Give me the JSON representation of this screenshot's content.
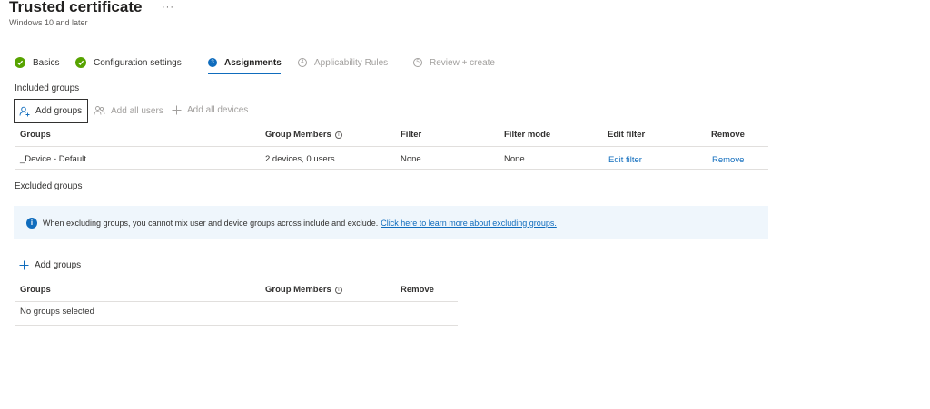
{
  "page": {
    "title": "Trusted certificate",
    "ellipsis": "···",
    "subtitle": "Windows 10 and later"
  },
  "steps": [
    {
      "label": "Basics",
      "state": "complete"
    },
    {
      "label": "Configuration settings",
      "state": "complete"
    },
    {
      "label": "Assignments",
      "state": "active",
      "number": "3"
    },
    {
      "label": "Applicability Rules",
      "state": "pending",
      "number": "4"
    },
    {
      "label": "Review + create",
      "state": "pending",
      "number": "5"
    }
  ],
  "included": {
    "heading": "Included groups",
    "commands": {
      "add_groups": "Add groups",
      "add_all_users": "Add all users",
      "add_all_devices": "Add all devices"
    },
    "columns": {
      "groups": "Groups",
      "group_members": "Group Members",
      "filter": "Filter",
      "filter_mode": "Filter mode",
      "edit_filter": "Edit filter",
      "remove": "Remove"
    },
    "rows": [
      {
        "group": "_Device - Default",
        "members": "2 devices, 0 users",
        "filter": "None",
        "filter_mode": "None",
        "edit_filter": "Edit filter",
        "remove": "Remove"
      }
    ]
  },
  "excluded": {
    "heading": "Excluded groups",
    "info_icon": "i",
    "info_text": "When excluding groups, you cannot mix user and device groups across include and exclude.",
    "info_link": "Click here to learn more about excluding groups.",
    "add_groups": "Add groups",
    "columns": {
      "groups": "Groups",
      "group_members": "Group Members",
      "remove": "Remove"
    },
    "empty_text": "No groups selected"
  },
  "colors": {
    "accent": "#0f6cbd",
    "success": "#57a300",
    "info_background": "#eff6fc"
  },
  "icons": {
    "step_complete": "checkmark-circle-icon",
    "info": "info-icon",
    "add_groups": "person-add-icon",
    "add_all_users": "people-icon",
    "add_all_devices": "plus-icon"
  }
}
